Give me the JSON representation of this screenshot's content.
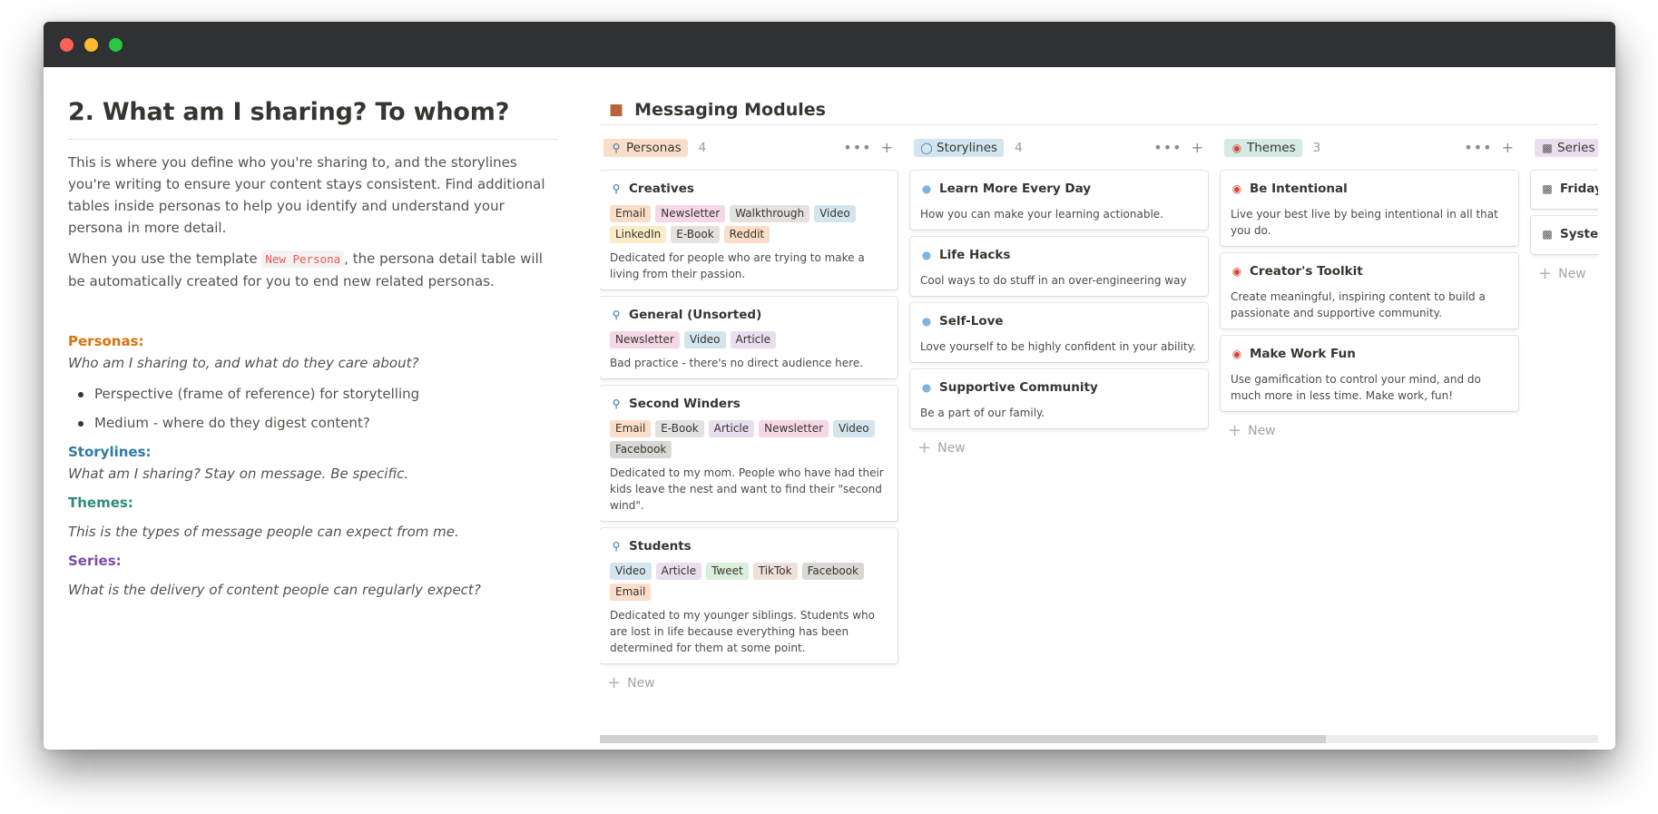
{
  "left": {
    "heading": "2. What am I sharing? To whom?",
    "intro": "This is where you define who you're sharing to, and the storylines you're writing to ensure your content stays consistent. Find additional tables inside personas to help you identify and understand your persona in more detail.",
    "template_before": "When you use the template ",
    "template_code": "New Persona",
    "template_after": ", the persona detail table will be automatically created for you to end new related personas.",
    "personas_label": "Personas:",
    "personas_desc": "Who am I sharing to, and what do they care about?",
    "bullets": [
      "Perspective (frame of reference) for storytelling",
      "Medium - where do they digest content?"
    ],
    "storylines_label": "Storylines:",
    "storylines_desc": "What am I sharing? Stay on message. Be specific.",
    "themes_label": "Themes:",
    "themes_desc": "This is the types of message people can expect from me.",
    "series_label": "Series:",
    "series_desc": "What is the delivery of content people can regularly expect?"
  },
  "board": {
    "title": "Messaging Modules",
    "icon": "cube-icon",
    "new_label": "New",
    "actions": {
      "more": "•••",
      "add": "+"
    },
    "columns": [
      {
        "name": "Personas",
        "count": "4",
        "icon": "search-icon",
        "cards": [
          {
            "title": "Creatives",
            "tags": [
              "Email",
              "Newsletter",
              "Walkthrough",
              "Video",
              "LinkedIn",
              "E-Book",
              "Reddit"
            ],
            "desc": "Dedicated for people who are trying to make a living from their passion."
          },
          {
            "title": "General (Unsorted)",
            "tags": [
              "Newsletter",
              "Video",
              "Article"
            ],
            "desc": "Bad practice - there's no direct audience here."
          },
          {
            "title": "Second Winders",
            "tags": [
              "Email",
              "E-Book",
              "Article",
              "Newsletter",
              "Video",
              "Facebook"
            ],
            "desc": "Dedicated to my mom. People who have had their kids leave the nest and want to find their \"second wind\"."
          },
          {
            "title": "Students",
            "tags": [
              "Video",
              "Article",
              "Tweet",
              "TikTok",
              "Facebook",
              "Email"
            ],
            "desc": "Dedicated to my younger siblings. Students who are lost in life because everything has been determined for them at some point."
          }
        ]
      },
      {
        "name": "Storylines",
        "count": "4",
        "icon": "speech-bubble-icon",
        "cards": [
          {
            "title": "Learn More Every Day",
            "desc": "How you can make your learning actionable."
          },
          {
            "title": "Life Hacks",
            "desc": "Cool ways to do stuff in an over-engineering way"
          },
          {
            "title": "Self-Love",
            "desc": "Love yourself to be highly confident in your ability."
          },
          {
            "title": "Supportive Community",
            "desc": "Be a part of our family."
          }
        ]
      },
      {
        "name": "Themes",
        "count": "3",
        "icon": "target-icon",
        "cards": [
          {
            "title": "Be Intentional",
            "desc": "Live your best live by being intentional in all that you do."
          },
          {
            "title": "Creator's Toolkit",
            "desc": "Create meaningful, inspiring content to build a passionate and supportive community."
          },
          {
            "title": "Make Work Fun",
            "desc": "Use gamification to control your mind, and do much more in less time. Make work, fun!"
          }
        ]
      },
      {
        "name": "Series",
        "icon": "calendar-icon",
        "cards": [
          {
            "title": "Friday"
          },
          {
            "title": "System"
          }
        ]
      }
    ]
  },
  "colors": {
    "titlebar": "#2f3134",
    "personas_tag": "#fadec9",
    "storylines_tag": "#d3e5ef",
    "themes_tag": "#d4ebe4",
    "series_tag": "#e8deee"
  }
}
